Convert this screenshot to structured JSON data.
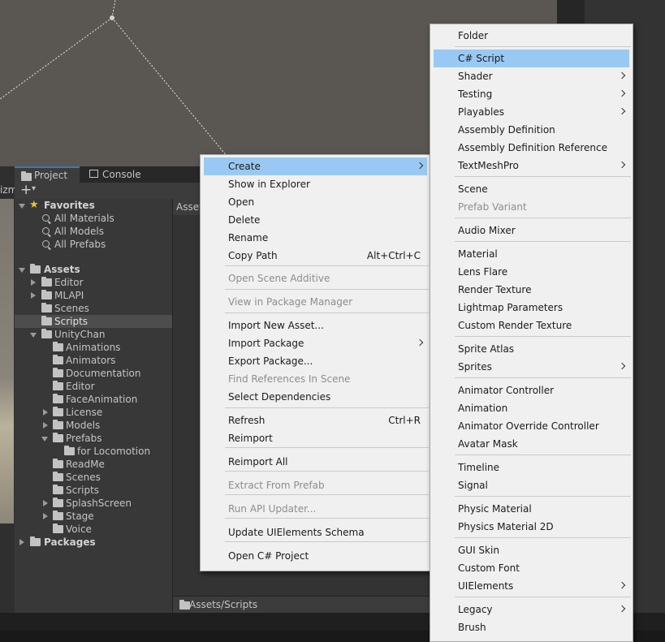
{
  "tabs": {
    "project": "Project",
    "console": "Console"
  },
  "left_strip": {
    "label": "izm"
  },
  "toolbar": {
    "add_label": "+",
    "add_caret": "▾"
  },
  "content": {
    "header": "Asset",
    "footer_path": "Assets/Scripts"
  },
  "tree": {
    "favorites": "Favorites",
    "favorite_items": [
      "All Materials",
      "All Models",
      "All Prefabs"
    ],
    "assets": "Assets",
    "assets_children": [
      "Editor",
      "MLAPI",
      "Scenes",
      "Scripts"
    ],
    "unitychan": "UnityChan",
    "unitychan_children": [
      "Animations",
      "Animators",
      "Documentation",
      "Editor",
      "FaceAnimation",
      "License",
      "Models",
      "Prefabs"
    ],
    "prefabs_children": [
      "for Locomotion"
    ],
    "unitychan_rest": [
      "ReadMe",
      "Scenes",
      "Scripts",
      "SplashScreen",
      "Stage",
      "Voice"
    ],
    "packages": "Packages"
  },
  "context_menu": {
    "items": [
      {
        "label": "Create",
        "submenu": true,
        "highlighted": true
      },
      {
        "label": "Show in Explorer"
      },
      {
        "label": "Open"
      },
      {
        "label": "Delete"
      },
      {
        "label": "Rename"
      },
      {
        "label": "Copy Path",
        "shortcut": "Alt+Ctrl+C"
      },
      {
        "label": "Open Scene Additive",
        "disabled": true
      },
      {
        "label": "View in Package Manager",
        "disabled": true
      },
      {
        "label": "Import New Asset..."
      },
      {
        "label": "Import Package",
        "submenu": true
      },
      {
        "label": "Export Package..."
      },
      {
        "label": "Find References In Scene",
        "disabled": true
      },
      {
        "label": "Select Dependencies"
      },
      {
        "label": "Refresh",
        "shortcut": "Ctrl+R"
      },
      {
        "label": "Reimport"
      },
      {
        "label": "Reimport All"
      },
      {
        "label": "Extract From Prefab",
        "disabled": true
      },
      {
        "label": "Run API Updater...",
        "disabled": true
      },
      {
        "label": "Update UIElements Schema"
      },
      {
        "label": "Open C# Project"
      }
    ]
  },
  "create_menu": {
    "items": [
      {
        "label": "Folder"
      },
      {
        "label": "C# Script",
        "highlighted": true
      },
      {
        "label": "Shader",
        "submenu": true
      },
      {
        "label": "Testing",
        "submenu": true
      },
      {
        "label": "Playables",
        "submenu": true
      },
      {
        "label": "Assembly Definition"
      },
      {
        "label": "Assembly Definition Reference"
      },
      {
        "label": "TextMeshPro",
        "submenu": true
      },
      {
        "label": "Scene"
      },
      {
        "label": "Prefab Variant",
        "disabled": true
      },
      {
        "label": "Audio Mixer"
      },
      {
        "label": "Material"
      },
      {
        "label": "Lens Flare"
      },
      {
        "label": "Render Texture"
      },
      {
        "label": "Lightmap Parameters"
      },
      {
        "label": "Custom Render Texture"
      },
      {
        "label": "Sprite Atlas"
      },
      {
        "label": "Sprites",
        "submenu": true
      },
      {
        "label": "Animator Controller"
      },
      {
        "label": "Animation"
      },
      {
        "label": "Animator Override Controller"
      },
      {
        "label": "Avatar Mask"
      },
      {
        "label": "Timeline"
      },
      {
        "label": "Signal"
      },
      {
        "label": "Physic Material"
      },
      {
        "label": "Physics Material 2D"
      },
      {
        "label": "GUI Skin"
      },
      {
        "label": "Custom Font"
      },
      {
        "label": "UIElements",
        "submenu": true
      },
      {
        "label": "Legacy",
        "submenu": true
      },
      {
        "label": "Brush"
      }
    ]
  }
}
